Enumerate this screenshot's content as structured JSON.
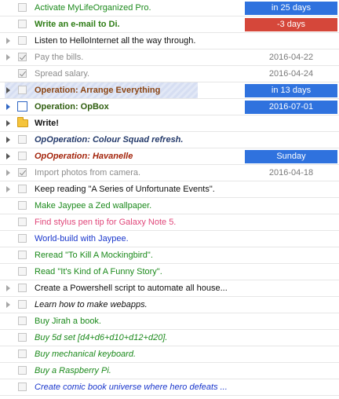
{
  "colors": {
    "due_blue": "#2f72de",
    "overdue_red": "#d5473a",
    "selection": "#dde4f4"
  },
  "tasks": [
    {
      "label": "Activate MyLifeOrganized Pro.",
      "due": "in 25 days"
    },
    {
      "label": "Write an e-mail to Di.",
      "due": "-3 days"
    },
    {
      "label": "Listen to HelloInternet all the way through.",
      "due": ""
    },
    {
      "label": "Pay the bills.",
      "due": "2016-04-22"
    },
    {
      "label": "Spread salary.",
      "due": "2016-04-24"
    },
    {
      "label": "Operation: Arrange Everything",
      "due": "in 13 days"
    },
    {
      "label": "Operation: OpBox",
      "due": "2016-07-01"
    },
    {
      "label": "Write!",
      "due": ""
    },
    {
      "label": "OpOperation: Colour Squad refresh.",
      "due": ""
    },
    {
      "label": "OpOperation: Havanelle",
      "due": "Sunday"
    },
    {
      "label": "Import photos from camera.",
      "due": "2016-04-18"
    },
    {
      "label": "Keep reading \"A Series of Unfortunate Events\".",
      "due": ""
    },
    {
      "label": "Make Jaypee a Zed wallpaper.",
      "due": ""
    },
    {
      "label": "Find stylus pen tip for Galaxy Note 5.",
      "due": ""
    },
    {
      "label": "World-build with Jaypee.",
      "due": ""
    },
    {
      "label": "Reread \"To Kill A Mockingbird\".",
      "due": ""
    },
    {
      "label": "Read  \"It's Kind of A Funny Story\".",
      "due": ""
    },
    {
      "label": "Create a Powershell script to automate all house...",
      "due": ""
    },
    {
      "label": "Learn how to make webapps.",
      "due": ""
    },
    {
      "label": "Buy Jirah a book.",
      "due": ""
    },
    {
      "label": "Buy 5d set [d4+d6+d10+d12+d20].",
      "due": ""
    },
    {
      "label": "Buy mechanical keyboard.",
      "due": ""
    },
    {
      "label": "Buy a Raspberry Pi.",
      "due": ""
    },
    {
      "label": "Create comic book universe where hero defeats ...",
      "due": ""
    }
  ]
}
